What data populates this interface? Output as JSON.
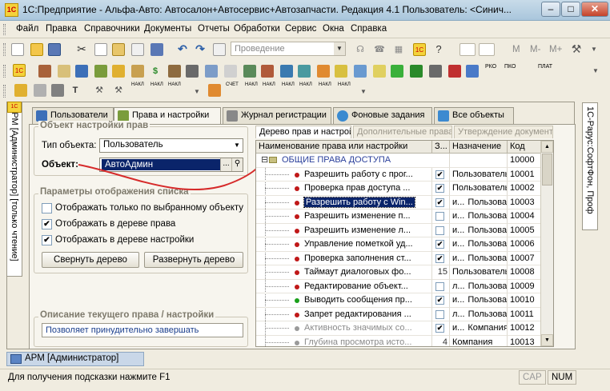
{
  "window": {
    "title": "1С:Предприятие - Альфа-Авто: Автосалон+Автосервис+Автозапчасти. Редакция 4.1     Пользователь: <Синич...",
    "app_icon": "1c-logo-icon",
    "minimize": "–",
    "maximize": "□",
    "close": "✕"
  },
  "menu": [
    "Файл",
    "Правка",
    "Справочники",
    "Документы",
    "Отчеты",
    "Обработки",
    "Сервис",
    "Окна",
    "Справка"
  ],
  "toolbar": {
    "process_combo": "Проведение",
    "font_buttons": [
      "M",
      "M-",
      "M+"
    ]
  },
  "toolbar2": {
    "labels": [
      "РКО",
      "ПКО",
      "ПЛАТ"
    ]
  },
  "toolbar3": {
    "labels": [
      "НАКЛ",
      "НАКЛ",
      "НАКЛ",
      "СЧЕТ",
      "НАКЛ",
      "НАКЛ",
      "НАКЛ",
      "НАКЛ",
      "НАКЛ",
      "НАКЛ"
    ]
  },
  "left_vertical_tab": "АРМ [Администратор] [только чтение]",
  "right_vertical_tab": "1С-Рарус:СофтФон, Проф",
  "tabs": [
    {
      "label": "Пользователи",
      "active": false
    },
    {
      "label": "Права и настройки",
      "active": true
    },
    {
      "label": "Журнал регистрации",
      "active": false
    },
    {
      "label": "Фоновые задания",
      "active": false
    },
    {
      "label": "Все объекты",
      "active": false
    }
  ],
  "object_settings": {
    "group_title": "Объект настройки прав",
    "type_label": "Тип объекта:",
    "type_value": "Пользователь",
    "object_label": "Объект:",
    "object_value": "АвтоАдмин",
    "search_button": "..."
  },
  "display_params": {
    "group_title": "Параметры отображения списка",
    "options": [
      {
        "label": "Отображать только по  выбранному объекту",
        "checked": false
      },
      {
        "label": "Отображать в дереве права",
        "checked": true
      },
      {
        "label": "Отображать в дереве настройки",
        "checked": true
      }
    ],
    "collapse_button": "Свернуть дерево",
    "expand_button": "Развернуть дерево"
  },
  "description": {
    "group_title": "Описание текущего права / настройки",
    "text": "Позволяет принудительно завершать"
  },
  "subtabs": [
    {
      "label": "Дерево прав и настройки",
      "active": true
    },
    {
      "label": "Дополнительные права",
      "active": false
    },
    {
      "label": "Утверждение документов",
      "active": false
    }
  ],
  "grid": {
    "columns": [
      "Наименование права или настройки",
      "З...",
      "Назначение",
      "Код"
    ],
    "group_row": {
      "name": "ОБЩИЕ ПРАВА ДОСТУПА",
      "purpose": "",
      "code": "10000"
    },
    "rows": [
      {
        "name": "Разрешить работу с прог...",
        "check": "✔",
        "value": "",
        "purpose": "Пользователь",
        "code": "10001",
        "dot": "red",
        "selected": false
      },
      {
        "name": "Проверка прав доступа ...",
        "check": "✔",
        "value": "",
        "purpose": "Пользователь",
        "code": "10002",
        "dot": "red",
        "selected": false
      },
      {
        "name": "Разрешить работу с Win...",
        "check": "✔",
        "value": "и...",
        "purpose": "Пользователь",
        "code": "10003",
        "dot": "red",
        "selected": true
      },
      {
        "name": "Разрешить изменение п...",
        "check": "",
        "value": "и...",
        "purpose": "Пользователь",
        "code": "10004",
        "dot": "red",
        "selected": false
      },
      {
        "name": "Разрешить изменение л...",
        "check": "",
        "value": "и...",
        "purpose": "Пользователь",
        "code": "10005",
        "dot": "red",
        "selected": false
      },
      {
        "name": "Управление пометкой уд...",
        "check": "✔",
        "value": "и...",
        "purpose": "Пользователь",
        "code": "10006",
        "dot": "red",
        "selected": false
      },
      {
        "name": "Проверка заполнения ст...",
        "check": "✔",
        "value": "и...",
        "purpose": "Пользователь",
        "code": "10007",
        "dot": "red",
        "selected": false
      },
      {
        "name": "Таймаут диалоговых фо...",
        "check": "",
        "value": "15",
        "purpose": "Пользователь",
        "code": "10008",
        "dot": "red",
        "selected": false
      },
      {
        "name": "Редактирование объект...",
        "check": "",
        "value": "л...",
        "purpose": "Пользователь",
        "code": "10009",
        "dot": "red",
        "selected": false
      },
      {
        "name": "Выводить сообщения пр...",
        "check": "✔",
        "value": "и...",
        "purpose": "Пользователь",
        "code": "10010",
        "dot": "green",
        "selected": false
      },
      {
        "name": "Запрет редактирования ...",
        "check": "",
        "value": "л...",
        "purpose": "Пользователь",
        "code": "10011",
        "dot": "red",
        "selected": false
      },
      {
        "name": "Активность значимых со...",
        "check": "✔",
        "value": "и...",
        "purpose": "Компания",
        "code": "10012",
        "dot": "gray",
        "selected": false
      },
      {
        "name": "Глубина просмотра исто...",
        "check": "",
        "value": "4",
        "purpose": "Компания",
        "code": "10013",
        "dot": "gray",
        "selected": false
      }
    ]
  },
  "taskbar": {
    "window_button": "АРМ [Администратор]"
  },
  "status": {
    "hint": "Для получения подсказки нажмите F1",
    "cap": "CAP",
    "num": "NUM"
  }
}
